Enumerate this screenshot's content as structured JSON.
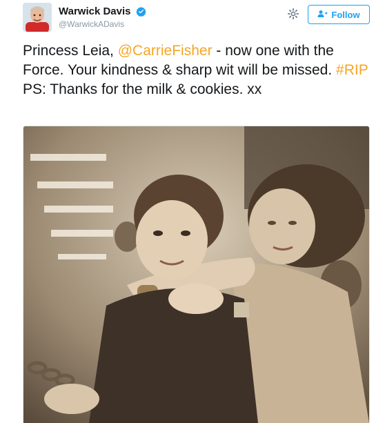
{
  "author": {
    "display_name": "Warwick Davis",
    "handle": "@WarwickADavis",
    "verified": true,
    "avatar_icon": "avatar-photo"
  },
  "actions": {
    "settings_icon": "gear-icon",
    "follow_label": "Follow",
    "follow_icon": "add-user-icon"
  },
  "tweet": {
    "segments": [
      {
        "text": "Princess Leia, ",
        "type": "text"
      },
      {
        "text": "@CarrieFisher",
        "type": "mention"
      },
      {
        "text": " - now one with the Force. Your kindness & sharp wit will be missed. ",
        "type": "text"
      },
      {
        "text": "#RIP",
        "type": "hashtag"
      },
      {
        "text": " PS: Thanks for the milk & cookies. xx",
        "type": "text"
      }
    ]
  },
  "colors": {
    "link": "#f5a623",
    "accent": "#1da1f2",
    "handle": "#8899a6"
  }
}
